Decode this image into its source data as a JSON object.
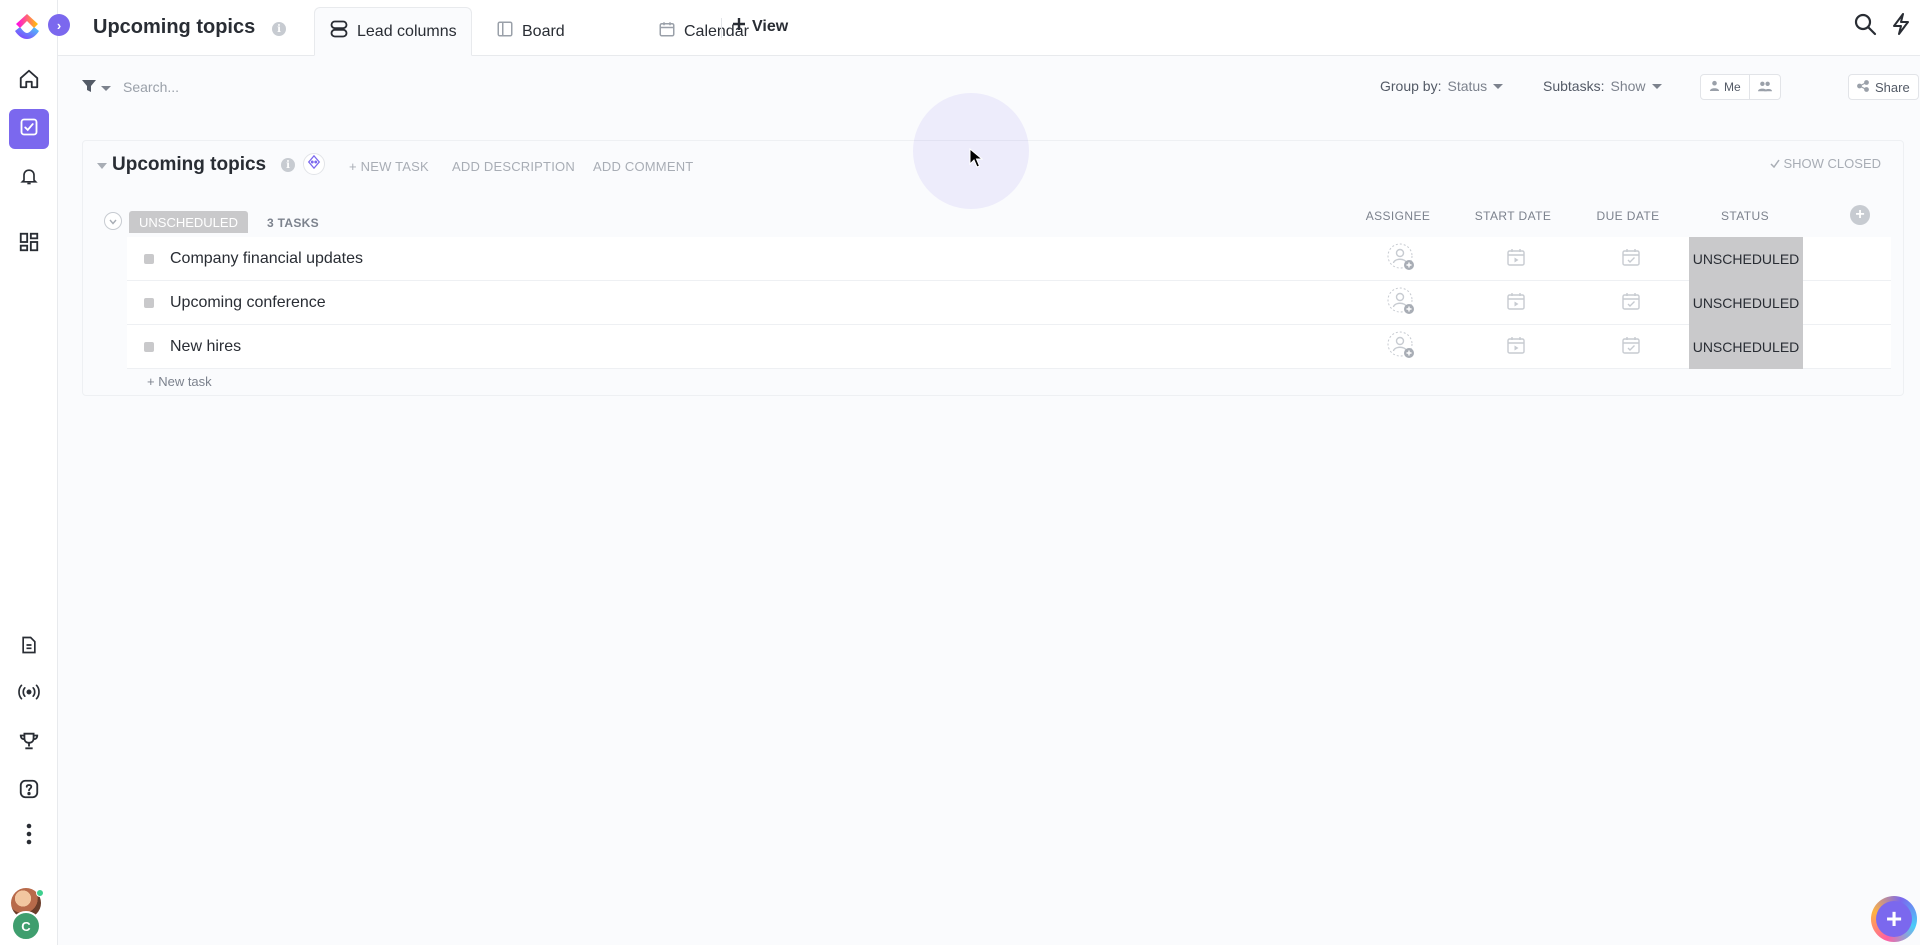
{
  "app": {
    "accent_color": "#7b68ee",
    "status_gray": "#c9c9cb",
    "avatar_initial": "C"
  },
  "header": {
    "title": "Upcoming topics",
    "tabs": [
      {
        "label": "Lead columns",
        "icon": "list-view-icon",
        "active": true
      },
      {
        "label": "Board",
        "icon": "board-view-icon",
        "active": false
      },
      {
        "label": "Calendar",
        "icon": "calendar-view-icon",
        "active": false
      }
    ],
    "add_view_label": "View"
  },
  "toolbar": {
    "search_placeholder": "Search...",
    "group_by_label": "Group by:",
    "group_by_value": "Status",
    "subtasks_label": "Subtasks:",
    "subtasks_value": "Show",
    "me_label": "Me",
    "share_label": "Share"
  },
  "list": {
    "title": "Upcoming topics",
    "new_task_label": "+ NEW TASK",
    "add_description_label": "ADD DESCRIPTION",
    "add_comment_label": "ADD COMMENT",
    "show_closed_label": "SHOW CLOSED",
    "group": {
      "status": "UNSCHEDULED",
      "count_label": "3 TASKS"
    },
    "columns": {
      "assignee": "ASSIGNEE",
      "start_date": "START DATE",
      "due_date": "DUE DATE",
      "status": "STATUS"
    },
    "tasks": [
      {
        "name": "Company financial updates",
        "status": "UNSCHEDULED"
      },
      {
        "name": "Upcoming conference",
        "status": "UNSCHEDULED"
      },
      {
        "name": "New hires",
        "status": "UNSCHEDULED"
      }
    ],
    "add_task_link": "+ New task"
  }
}
